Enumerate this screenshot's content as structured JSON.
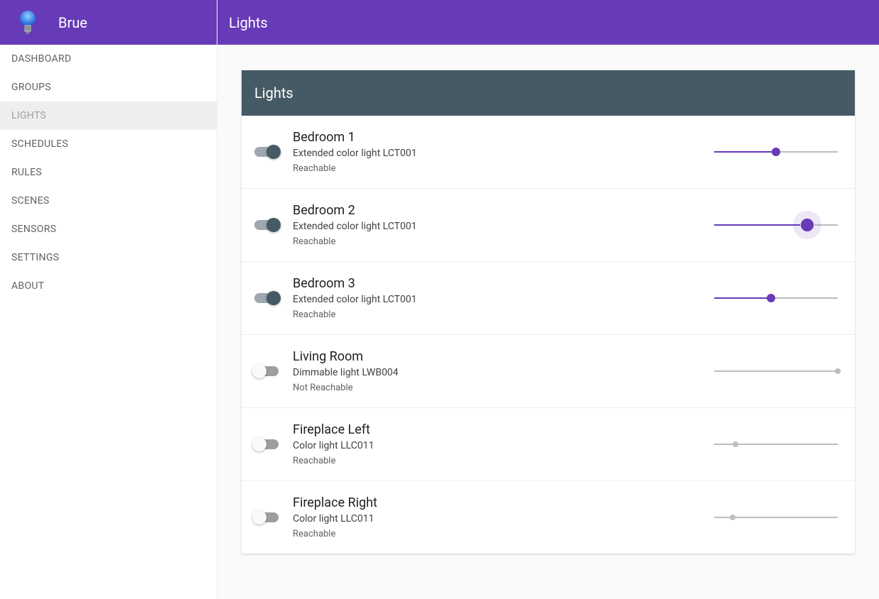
{
  "app": {
    "title": "Brue"
  },
  "sidebar": {
    "items": [
      {
        "label": "DASHBOARD"
      },
      {
        "label": "GROUPS"
      },
      {
        "label": "LIGHTS"
      },
      {
        "label": "SCHEDULES"
      },
      {
        "label": "RULES"
      },
      {
        "label": "SCENES"
      },
      {
        "label": "SENSORS"
      },
      {
        "label": "SETTINGS"
      },
      {
        "label": "ABOUT"
      }
    ],
    "active_index": 2
  },
  "page": {
    "title": "Lights"
  },
  "panel": {
    "title": "Lights"
  },
  "colors": {
    "primary": "#673ab7",
    "toggle_on_thumb": "#455A64"
  },
  "lights": [
    {
      "name": "Bedroom 1",
      "type": "Extended color light LCT001",
      "status": "Reachable",
      "on": true,
      "brightness": 50,
      "active": true,
      "focus": false
    },
    {
      "name": "Bedroom 2",
      "type": "Extended color light LCT001",
      "status": "Reachable",
      "on": true,
      "brightness": 75,
      "active": true,
      "focus": true
    },
    {
      "name": "Bedroom 3",
      "type": "Extended color light LCT001",
      "status": "Reachable",
      "on": true,
      "brightness": 46,
      "active": true,
      "focus": false
    },
    {
      "name": "Living Room",
      "type": "Dimmable light LWB004",
      "status": "Not Reachable",
      "on": false,
      "brightness": 100,
      "active": false,
      "focus": false
    },
    {
      "name": "Fireplace Left",
      "type": "Color light LLC011",
      "status": "Reachable",
      "on": false,
      "brightness": 17,
      "active": false,
      "focus": false
    },
    {
      "name": "Fireplace Right",
      "type": "Color light LLC011",
      "status": "Reachable",
      "on": false,
      "brightness": 15,
      "active": false,
      "focus": false
    }
  ]
}
